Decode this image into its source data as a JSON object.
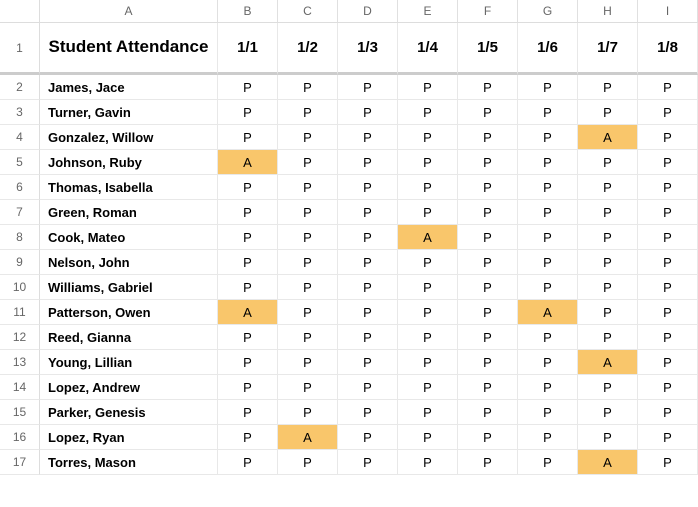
{
  "columns": [
    "A",
    "B",
    "C",
    "D",
    "E",
    "F",
    "G",
    "H",
    "I"
  ],
  "title": "Student Attendance",
  "dates": [
    "1/1",
    "1/2",
    "1/3",
    "1/4",
    "1/5",
    "1/6",
    "1/7",
    "1/8"
  ],
  "rows": [
    {
      "n": 2,
      "name": "James, Jace",
      "v": [
        "P",
        "P",
        "P",
        "P",
        "P",
        "P",
        "P",
        "P"
      ]
    },
    {
      "n": 3,
      "name": "Turner, Gavin",
      "v": [
        "P",
        "P",
        "P",
        "P",
        "P",
        "P",
        "P",
        "P"
      ]
    },
    {
      "n": 4,
      "name": "Gonzalez, Willow",
      "v": [
        "P",
        "P",
        "P",
        "P",
        "P",
        "P",
        "A",
        "P"
      ]
    },
    {
      "n": 5,
      "name": "Johnson, Ruby",
      "v": [
        "A",
        "P",
        "P",
        "P",
        "P",
        "P",
        "P",
        "P"
      ]
    },
    {
      "n": 6,
      "name": "Thomas, Isabella",
      "v": [
        "P",
        "P",
        "P",
        "P",
        "P",
        "P",
        "P",
        "P"
      ]
    },
    {
      "n": 7,
      "name": "Green, Roman",
      "v": [
        "P",
        "P",
        "P",
        "P",
        "P",
        "P",
        "P",
        "P"
      ]
    },
    {
      "n": 8,
      "name": "Cook, Mateo",
      "v": [
        "P",
        "P",
        "P",
        "A",
        "P",
        "P",
        "P",
        "P"
      ]
    },
    {
      "n": 9,
      "name": "Nelson, John",
      "v": [
        "P",
        "P",
        "P",
        "P",
        "P",
        "P",
        "P",
        "P"
      ]
    },
    {
      "n": 10,
      "name": "Williams, Gabriel",
      "v": [
        "P",
        "P",
        "P",
        "P",
        "P",
        "P",
        "P",
        "P"
      ]
    },
    {
      "n": 11,
      "name": "Patterson, Owen",
      "v": [
        "A",
        "P",
        "P",
        "P",
        "P",
        "A",
        "P",
        "P"
      ]
    },
    {
      "n": 12,
      "name": "Reed, Gianna",
      "v": [
        "P",
        "P",
        "P",
        "P",
        "P",
        "P",
        "P",
        "P"
      ]
    },
    {
      "n": 13,
      "name": "Young, Lillian",
      "v": [
        "P",
        "P",
        "P",
        "P",
        "P",
        "P",
        "A",
        "P"
      ]
    },
    {
      "n": 14,
      "name": "Lopez, Andrew",
      "v": [
        "P",
        "P",
        "P",
        "P",
        "P",
        "P",
        "P",
        "P"
      ]
    },
    {
      "n": 15,
      "name": "Parker, Genesis",
      "v": [
        "P",
        "P",
        "P",
        "P",
        "P",
        "P",
        "P",
        "P"
      ]
    },
    {
      "n": 16,
      "name": "Lopez, Ryan",
      "v": [
        "P",
        "A",
        "P",
        "P",
        "P",
        "P",
        "P",
        "P"
      ]
    },
    {
      "n": 17,
      "name": "Torres, Mason",
      "v": [
        "P",
        "P",
        "P",
        "P",
        "P",
        "P",
        "A",
        "P"
      ]
    }
  ],
  "chart_data": {
    "type": "table",
    "title": "Student Attendance",
    "columns": [
      "Student",
      "1/1",
      "1/2",
      "1/3",
      "1/4",
      "1/5",
      "1/6",
      "1/7",
      "1/8"
    ],
    "rows": [
      [
        "James, Jace",
        "P",
        "P",
        "P",
        "P",
        "P",
        "P",
        "P",
        "P"
      ],
      [
        "Turner, Gavin",
        "P",
        "P",
        "P",
        "P",
        "P",
        "P",
        "P",
        "P"
      ],
      [
        "Gonzalez, Willow",
        "P",
        "P",
        "P",
        "P",
        "P",
        "P",
        "A",
        "P"
      ],
      [
        "Johnson, Ruby",
        "A",
        "P",
        "P",
        "P",
        "P",
        "P",
        "P",
        "P"
      ],
      [
        "Thomas, Isabella",
        "P",
        "P",
        "P",
        "P",
        "P",
        "P",
        "P",
        "P"
      ],
      [
        "Green, Roman",
        "P",
        "P",
        "P",
        "P",
        "P",
        "P",
        "P",
        "P"
      ],
      [
        "Cook, Mateo",
        "P",
        "P",
        "P",
        "A",
        "P",
        "P",
        "P",
        "P"
      ],
      [
        "Nelson, John",
        "P",
        "P",
        "P",
        "P",
        "P",
        "P",
        "P",
        "P"
      ],
      [
        "Williams, Gabriel",
        "P",
        "P",
        "P",
        "P",
        "P",
        "P",
        "P",
        "P"
      ],
      [
        "Patterson, Owen",
        "A",
        "P",
        "P",
        "P",
        "P",
        "A",
        "P",
        "P"
      ],
      [
        "Reed, Gianna",
        "P",
        "P",
        "P",
        "P",
        "P",
        "P",
        "P",
        "P"
      ],
      [
        "Young, Lillian",
        "P",
        "P",
        "P",
        "P",
        "P",
        "P",
        "A",
        "P"
      ],
      [
        "Lopez, Andrew",
        "P",
        "P",
        "P",
        "P",
        "P",
        "P",
        "P",
        "P"
      ],
      [
        "Parker, Genesis",
        "P",
        "P",
        "P",
        "P",
        "P",
        "P",
        "P",
        "P"
      ],
      [
        "Lopez, Ryan",
        "P",
        "A",
        "P",
        "P",
        "P",
        "P",
        "P",
        "P"
      ],
      [
        "Torres, Mason",
        "P",
        "P",
        "P",
        "P",
        "P",
        "P",
        "A",
        "P"
      ]
    ]
  }
}
